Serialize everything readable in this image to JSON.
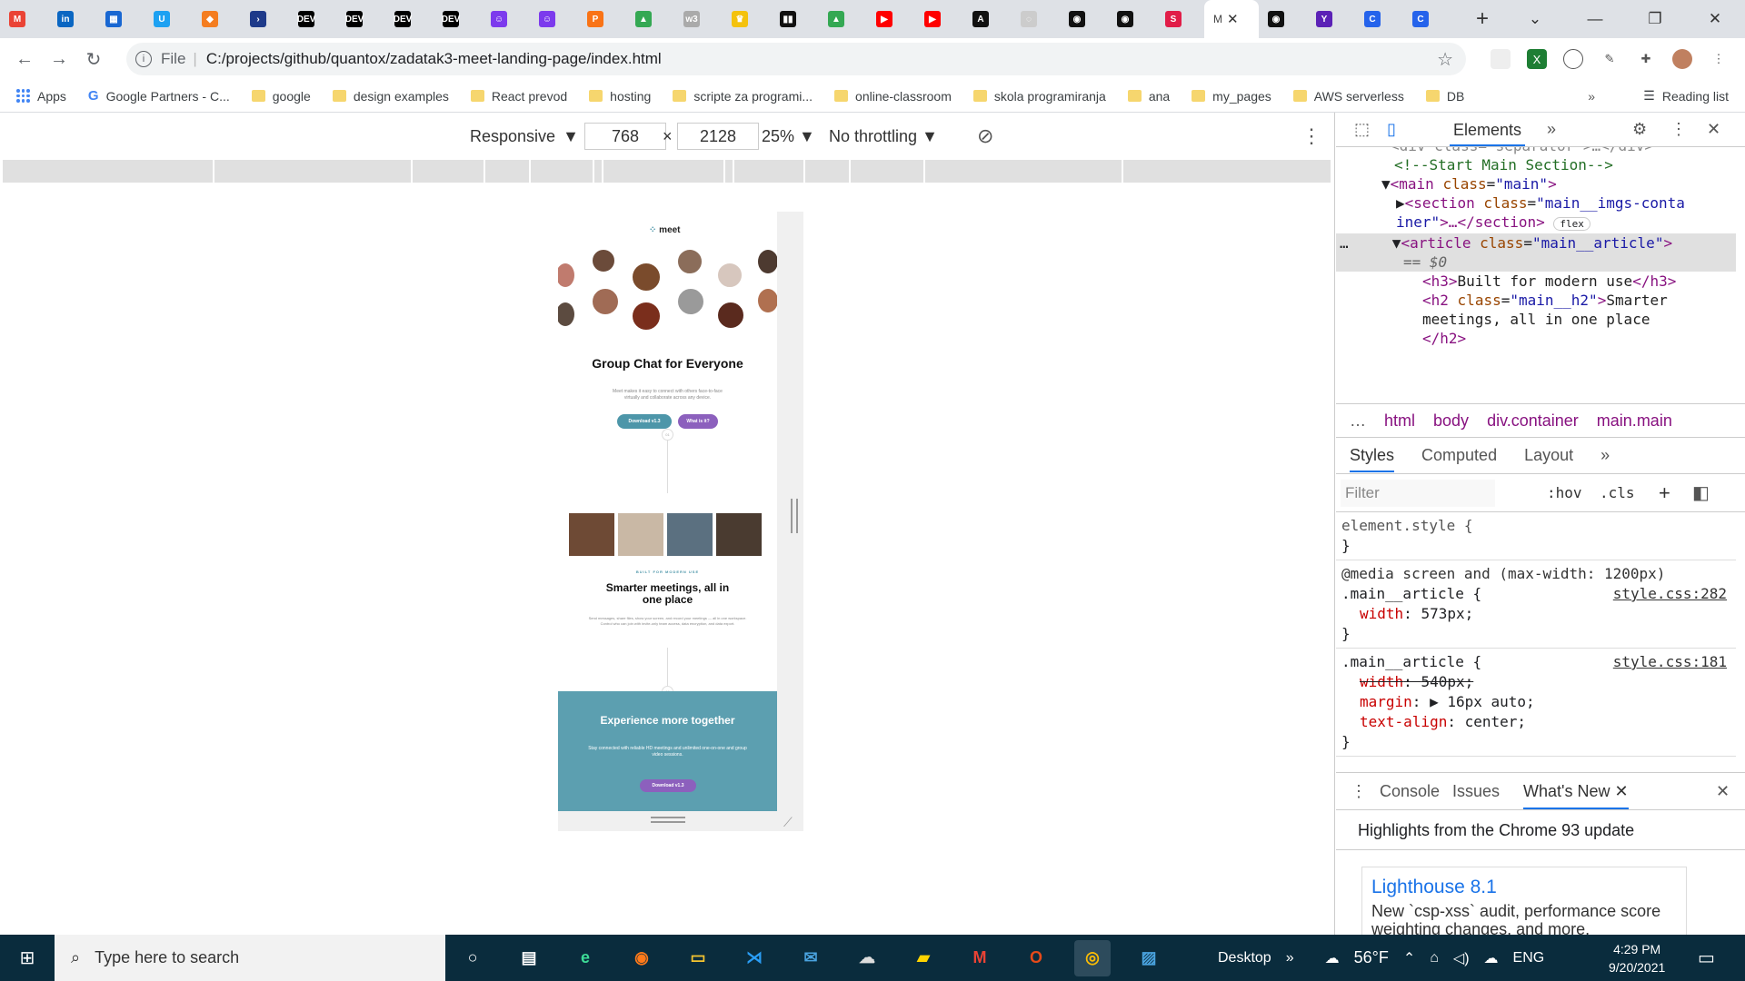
{
  "tabs": {
    "items": [
      {
        "label": "M",
        "color": "#ea4335",
        "icon": "gmail-icon"
      },
      {
        "label": "in",
        "color": "#0a66c2",
        "icon": "linkedin-icon"
      },
      {
        "label": "▦",
        "color": "#1967d2",
        "icon": "forms-icon"
      },
      {
        "label": "U",
        "color": "#1da1f2",
        "icon": "udemy-icon"
      },
      {
        "label": "◆",
        "color": "#f47d20",
        "icon": "cube-icon"
      },
      {
        "label": "›",
        "color": "#1e3a8a",
        "icon": "terminal-icon"
      },
      {
        "label": "DEV",
        "color": "#000000",
        "icon": "dev-icon"
      },
      {
        "label": "DEV",
        "color": "#000000",
        "icon": "dev-icon"
      },
      {
        "label": "DEV",
        "color": "#000000",
        "icon": "dev-icon"
      },
      {
        "label": "DEV",
        "color": "#000000",
        "icon": "dev-icon"
      },
      {
        "label": "☺",
        "color": "#7c3aed",
        "icon": "discord-icon"
      },
      {
        "label": "☺",
        "color": "#7c3aed",
        "icon": "discord-icon"
      },
      {
        "label": "P",
        "color": "#f97316",
        "icon": "postman-icon"
      },
      {
        "label": "▲",
        "color": "#34a853",
        "icon": "drive-icon"
      },
      {
        "label": "w3",
        "color": "#aaaaaa",
        "icon": "w3schools-icon"
      },
      {
        "label": "♛",
        "color": "#f4c20d",
        "icon": "crown-icon"
      },
      {
        "label": "▮▮",
        "color": "#111111",
        "icon": "trello-icon"
      },
      {
        "label": "▲",
        "color": "#34a853",
        "icon": "drive-icon"
      },
      {
        "label": "▶",
        "color": "#ff0000",
        "icon": "youtube-icon"
      },
      {
        "label": "▶",
        "color": "#ff0000",
        "icon": "youtube-icon"
      },
      {
        "label": "A",
        "color": "#111111",
        "icon": "app-icon"
      },
      {
        "label": "◌",
        "color": "#cccccc",
        "icon": "loading-icon"
      },
      {
        "label": "◉",
        "color": "#111111",
        "icon": "github-icon"
      },
      {
        "label": "◉",
        "color": "#111111",
        "icon": "github-icon"
      },
      {
        "label": "S",
        "color": "#e11d48",
        "icon": "scrimba-icon"
      }
    ],
    "active_label": "M",
    "after": [
      {
        "label": "◉",
        "color": "#111111",
        "icon": "github-icon"
      },
      {
        "label": "Y",
        "color": "#5b21b6",
        "icon": "yahoo-icon"
      },
      {
        "label": "C",
        "color": "#2563eb",
        "icon": "c-icon"
      },
      {
        "label": "C",
        "color": "#2563eb",
        "icon": "c-icon"
      }
    ]
  },
  "address": {
    "scheme": "File",
    "url": "C:/projects/github/quantox/zadatak3-meet-landing-page/index.html"
  },
  "bookmarks": [
    {
      "label": "Apps",
      "type": "apps"
    },
    {
      "label": "Google Partners - C...",
      "type": "google"
    },
    {
      "label": "google",
      "type": "folder"
    },
    {
      "label": "design examples",
      "type": "folder"
    },
    {
      "label": "React prevod",
      "type": "folder"
    },
    {
      "label": "hosting",
      "type": "folder"
    },
    {
      "label": "scripte za programi...",
      "type": "folder"
    },
    {
      "label": "online-classroom",
      "type": "folder"
    },
    {
      "label": "skola programiranja",
      "type": "folder"
    },
    {
      "label": "ana",
      "type": "folder"
    },
    {
      "label": "my_pages",
      "type": "folder"
    },
    {
      "label": "AWS serverless",
      "type": "folder"
    },
    {
      "label": "DB",
      "type": "folder"
    }
  ],
  "reading_list": "Reading list",
  "device_toolbar": {
    "mode": "Responsive",
    "width": "768",
    "height": "2128",
    "times": "×",
    "zoom": "25%",
    "throttling": "No throttling"
  },
  "preview": {
    "logo": "meet",
    "hero_title": "Group Chat for Everyone",
    "hero_sub": "Meet makes it easy to connect with others face-to-face virtually and collaborate across any device.",
    "btn_download": "Download v1.3",
    "btn_what": "What is it?",
    "step1": "01",
    "kicker": "BUILT FOR MODERN USE",
    "h2": "Smarter meetings, all in one place",
    "body": "Send messages, share files, show your screen, and record your meetings — all in one workspace. Control who can join with invite-only team access, data encryption, and data export.",
    "step2": "02",
    "cta_title": "Experience more together",
    "cta_sub": "Stay connected with reliable HD meetings and unlimited one-on-one and group video sessions.",
    "cta_btn": "Download v1.3"
  },
  "devtools": {
    "tab": "Elements",
    "code": {
      "l0": "<div class=\"separator\">…</div>",
      "l1": "<!--Start Main Section-->",
      "l2a": "<main",
      "l2b": "class",
      "l2c": "\"main\"",
      "l2d": ">",
      "l3a": "<section",
      "l3b": "class",
      "l3c": "\"main__imgs-conta",
      "l4a": "iner\"",
      "l4b": ">…</section>",
      "flex": "flex",
      "l5a": "<article",
      "l5b": "class",
      "l5c": "\"main__article\"",
      "l5d": ">",
      "l6": "== $0",
      "l7a": "<h3>",
      "l7b": "Built for modern use",
      "l7c": "</h3>",
      "l8a": "<h2",
      "l8b": "class",
      "l8c": "\"main__h2\"",
      "l8d": ">",
      "l8e": "Smarter",
      "l9": "meetings, all in one place",
      "l10": "</h2>"
    },
    "crumbs": [
      "html",
      "body",
      "div.container",
      "main.main"
    ],
    "style_tabs": [
      "Styles",
      "Computed",
      "Layout"
    ],
    "filter_placeholder": "Filter",
    "hov": ":hov",
    "cls": ".cls",
    "rules": {
      "r1_sel": "element.style {",
      "r1_close": "}",
      "r2_media": "@media screen and (max-width: 1200px)",
      "r2_sel": ".main__article {",
      "r2_src": "style.css:282",
      "r2_prop": "width",
      "r2_val": "573px;",
      "r2_close": "}",
      "r3_sel": ".main__article {",
      "r3_src": "style.css:181",
      "r3_p1": "width",
      "r3_v1": "540px;",
      "r3_p2": "margin",
      "r3_v2": "▶ 16px auto;",
      "r3_p3": "text-align",
      "r3_v3": "center;",
      "r3_close": "}"
    },
    "drawer_tabs": {
      "console": "Console",
      "issues": "Issues",
      "whats_new": "What's New"
    },
    "highlights": "Highlights from the Chrome 93 update",
    "card_title": "Lighthouse 8.1",
    "card_desc": "New `csp-xss` audit, performance score weighting changes, and more."
  },
  "taskbar": {
    "search": "Type here to search",
    "desktop": "Desktop",
    "temp": "56°F",
    "lang": "ENG",
    "time": "4:29 PM",
    "date": "9/20/2021"
  }
}
